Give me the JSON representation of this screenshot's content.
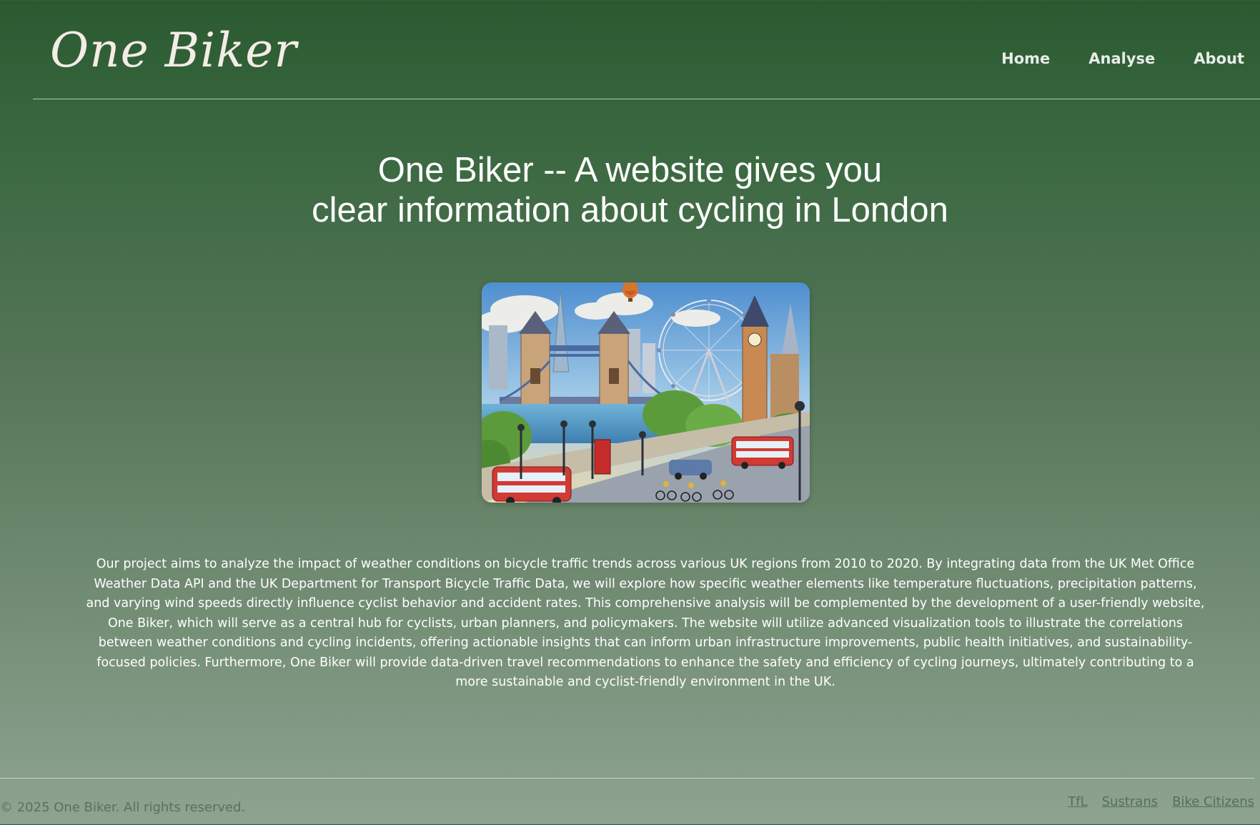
{
  "header": {
    "logo": "One Biker",
    "nav": [
      {
        "label": "Home"
      },
      {
        "label": "Analyse"
      },
      {
        "label": "About"
      }
    ]
  },
  "hero": {
    "title_line1": "One Biker -- A website gives you",
    "title_line2": "clear information about cycling in London",
    "image_alt": "Illustration of London with Tower Bridge, the London Eye, Big Ben, red buses and cyclists"
  },
  "description": "Our project aims to analyze the impact of weather conditions on bicycle traffic trends across various UK regions from 2010 to 2020. By integrating data from the UK Met Office Weather Data API and the UK Department for Transport Bicycle Traffic Data, we will explore how specific weather elements like temperature fluctuations, precipitation patterns, and varying wind speeds directly influence cyclist behavior and accident rates. This comprehensive analysis will be complemented by the development of a user-friendly website, One Biker, which will serve as a central hub for cyclists, urban planners, and policymakers. The website will utilize advanced visualization tools to illustrate the correlations between weather conditions and cycling incidents, offering actionable insights that can inform urban infrastructure improvements, public health initiatives, and sustainability-focused policies. Furthermore, One Biker will provide data-driven travel recommendations to enhance the safety and efficiency of cycling journeys, ultimately contributing to a more sustainable and cyclist-friendly environment in the UK.",
  "footer": {
    "copyright": "© 2025 One Biker. All rights reserved.",
    "links": [
      {
        "label": "TfL"
      },
      {
        "label": "Sustrans"
      },
      {
        "label": "Bike Citizens"
      }
    ]
  },
  "colors": {
    "background_top": "#2b5a31",
    "background_bottom": "#8ea491",
    "logo": "#f4ece6",
    "footer_text": "#5b7160"
  }
}
